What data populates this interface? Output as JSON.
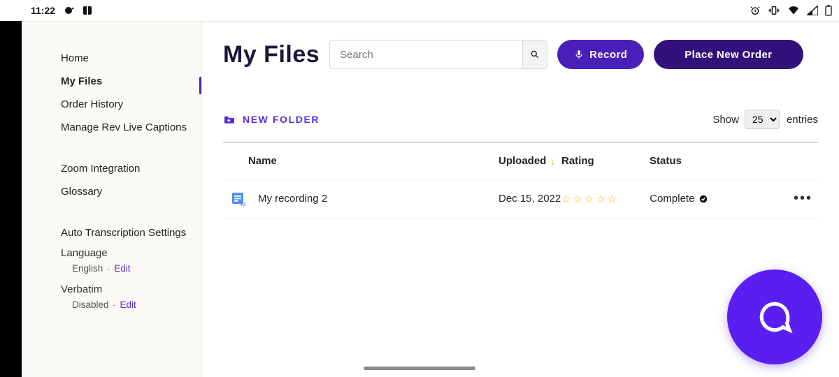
{
  "statusbar": {
    "time": "11:22"
  },
  "sidebar": {
    "items": [
      {
        "label": "Home"
      },
      {
        "label": "My Files"
      },
      {
        "label": "Order History"
      },
      {
        "label": "Manage Rev Live Captions"
      },
      {
        "label": "Zoom Integration"
      },
      {
        "label": "Glossary"
      }
    ],
    "settings_heading": "Auto Transcription Settings",
    "language": {
      "label": "Language",
      "value": "English",
      "edit": "Edit"
    },
    "verbatim": {
      "label": "Verbatim",
      "value": "Disabled",
      "edit": "Edit"
    }
  },
  "header": {
    "title": "My Files",
    "search_placeholder": "Search",
    "record_label": "Record",
    "order_label": "Place New Order"
  },
  "toolbar": {
    "new_folder": "NEW FOLDER",
    "show_label": "Show",
    "entries_value": "25",
    "entries_label": "entries"
  },
  "table": {
    "columns": {
      "name": "Name",
      "uploaded": "Uploaded",
      "rating": "Rating",
      "status": "Status"
    },
    "rows": [
      {
        "name": "My recording 2",
        "uploaded": "Dec 15, 2022",
        "rating": 0,
        "status": "Complete"
      }
    ]
  }
}
